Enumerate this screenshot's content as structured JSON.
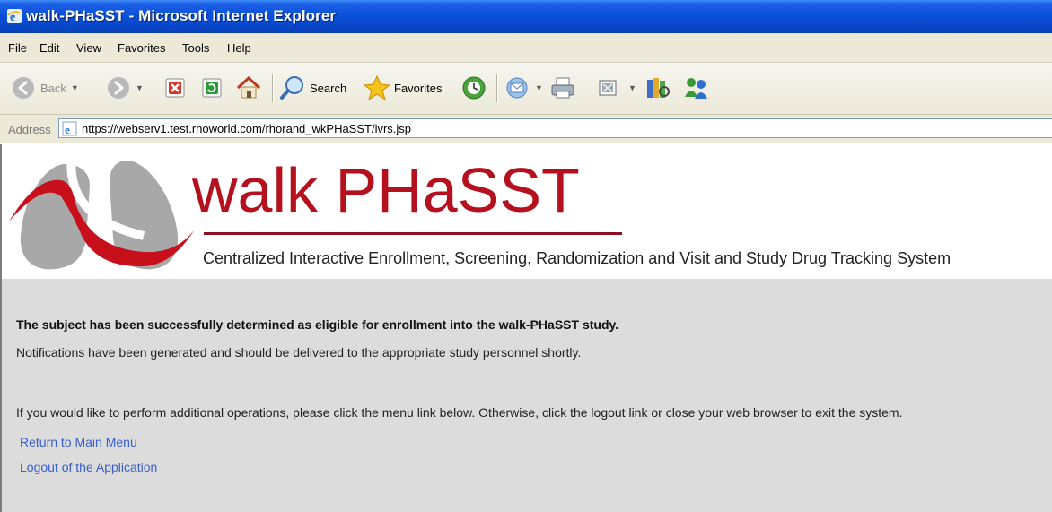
{
  "window": {
    "title": "walk-PHaSST - Microsoft Internet Explorer"
  },
  "menu": [
    "File",
    "Edit",
    "View",
    "Favorites",
    "Tools",
    "Help"
  ],
  "toolbar": {
    "back_label": "Back",
    "search_label": "Search",
    "favorites_label": "Favorites"
  },
  "address": {
    "label": "Address",
    "url": "https://webserv1.test.rhoworld.com/rhorand_wkPHaSST/ivrs.jsp"
  },
  "banner": {
    "brand": "walk PHaSST",
    "subtitle": "Centralized Interactive Enrollment, Screening, Randomization and Visit and Study Drug Tracking System"
  },
  "content": {
    "success": "The subject has been successfully determined as eligible for enrollment into the walk-PHaSST study.",
    "notification": "Notifications have been generated and should be delivered to the appropriate study personnel shortly.",
    "instruction": "If you would like to perform additional operations, please click the menu link below. Otherwise, click the logout link or close your web browser to exit the system.",
    "links": [
      "Return to Main Menu",
      "Logout of the Application"
    ]
  },
  "colors": {
    "titlebar": "#0a4fd8",
    "chrome": "#ece9d8",
    "brand_red": "#b4101e",
    "content_bg": "#dcdcdc",
    "link": "#3a5fcd"
  }
}
